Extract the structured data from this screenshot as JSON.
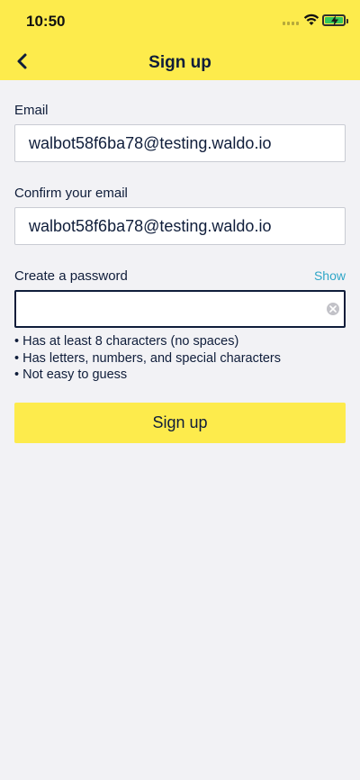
{
  "status_bar": {
    "time": "10:50",
    "signal_icon": "cellular-signal-icon",
    "wifi_icon": "wifi-icon",
    "battery_icon": "battery-charging-icon",
    "battery_color": "#35c759"
  },
  "header": {
    "title": "Sign up",
    "back_icon": "chevron-left-icon",
    "background": "#fdeb4c"
  },
  "form": {
    "email_label": "Email",
    "email_value": "walbot58f6ba78@testing.waldo.io",
    "confirm_label": "Confirm your email",
    "confirm_value": "walbot58f6ba78@testing.waldo.io",
    "password_label": "Create a password",
    "password_value": "",
    "show_label": "Show",
    "clear_icon": "clear-circle-icon",
    "rules": [
      "• Has at least 8 characters (no spaces)",
      "• Has letters, numbers, and special characters",
      "• Not easy to guess"
    ],
    "submit_label": "Sign up"
  },
  "colors": {
    "accent_yellow": "#fdeb4c",
    "text_navy": "#0f1d3a",
    "link_blue": "#2fa6c7",
    "background": "#f2f2f5"
  }
}
